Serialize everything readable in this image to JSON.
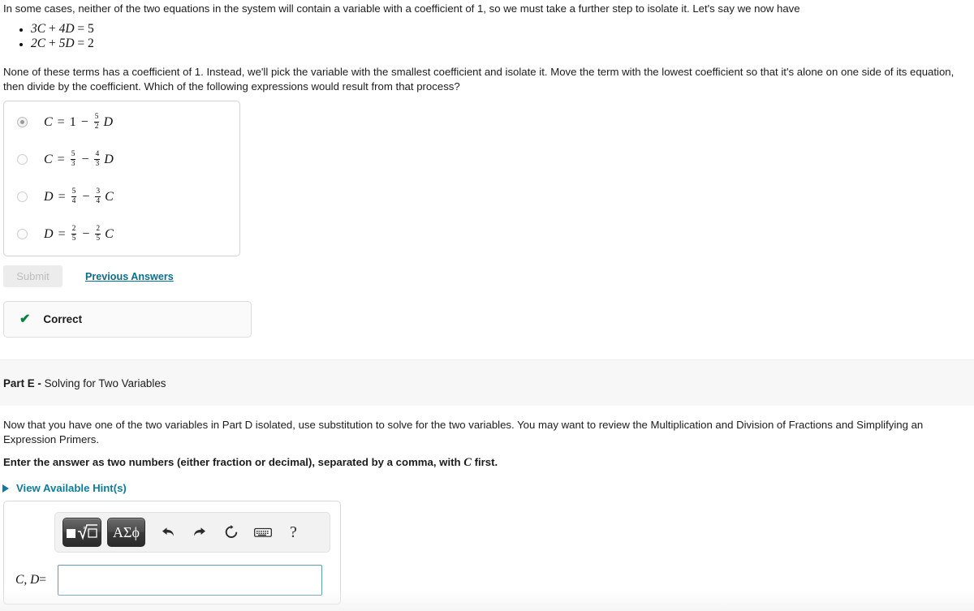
{
  "intro": {
    "text": "In some cases, neither of the two equations in the system will contain a variable with a coefficient of 1, so we must take a further step to isolate it. Let's say we now have",
    "equations": [
      "3C + 4D = 5",
      "2C + 5D = 2"
    ],
    "explanation": "None of these terms has a coefficient of 1. Instead, we'll pick the variable with the smallest coefficient and isolate it. Move the term with the lowest coefficient so that it's alone on one side of its equation, then divide by the coefficient. Which of the following expressions would result from that process?"
  },
  "options": [
    {
      "id": "option-a",
      "text": "C = 1 − 5/2 D",
      "lhs": "C",
      "rel": "=",
      "first": "1",
      "sign": "−",
      "frac_num": "5",
      "frac_den": "2",
      "var": "D",
      "selected": true
    },
    {
      "id": "option-b",
      "text": "C = 5/3 − 4/3 D",
      "lhs": "C",
      "rel": "=",
      "first_num": "5",
      "first_den": "3",
      "sign": "−",
      "frac_num": "4",
      "frac_den": "3",
      "var": "D",
      "selected": false
    },
    {
      "id": "option-c",
      "text": "D = 5/4 − 3/4 C",
      "lhs": "D",
      "rel": "=",
      "first_num": "5",
      "first_den": "4",
      "sign": "−",
      "frac_num": "3",
      "frac_den": "4",
      "var": "C",
      "selected": false
    },
    {
      "id": "option-d",
      "text": "D = 2/5 − 2/5 C",
      "lhs": "D",
      "rel": "=",
      "first_num": "2",
      "first_den": "5",
      "sign": "−",
      "frac_num": "2",
      "frac_den": "5",
      "var": "C",
      "selected": false
    }
  ],
  "actions": {
    "submit_label": "Submit",
    "previous_answers_label": "Previous Answers"
  },
  "feedback": {
    "check_glyph": "✔",
    "label": "Correct",
    "color": "#00843d"
  },
  "part": {
    "label": "Part E -",
    "title": "Solving for Two Variables",
    "description": "Now that you have one of the two variables in Part D isolated, use substitution to solve for the two variables. You may want to review the Multiplication and Division of Fractions and Simplifying an Expression Primers.",
    "instruction_prefix": "Enter the answer as two numbers (either fraction or decimal), separated by a comma, with",
    "instruction_var": "C",
    "instruction_suffix": "first.",
    "hints_label": "View Available Hint(s)",
    "hints_caret": "caret-right-icon"
  },
  "answer": {
    "label_vars": "C, D",
    "label_equals": "=",
    "input_value": "",
    "input_placeholder": "",
    "palette": {
      "math_button": "template-root-icon",
      "greek_button": "ΑΣϕ",
      "undo": "undo-icon",
      "redo": "redo-icon",
      "reset": "reset-icon",
      "keyboard": "keyboard-icon",
      "help": "?"
    }
  },
  "colors": {
    "link": "#0f7b9c",
    "link_underlined": "#0a6e8a",
    "correct_green": "#00843d",
    "input_border": "#5b9bb5",
    "band_bg": "#f7f7f7"
  }
}
